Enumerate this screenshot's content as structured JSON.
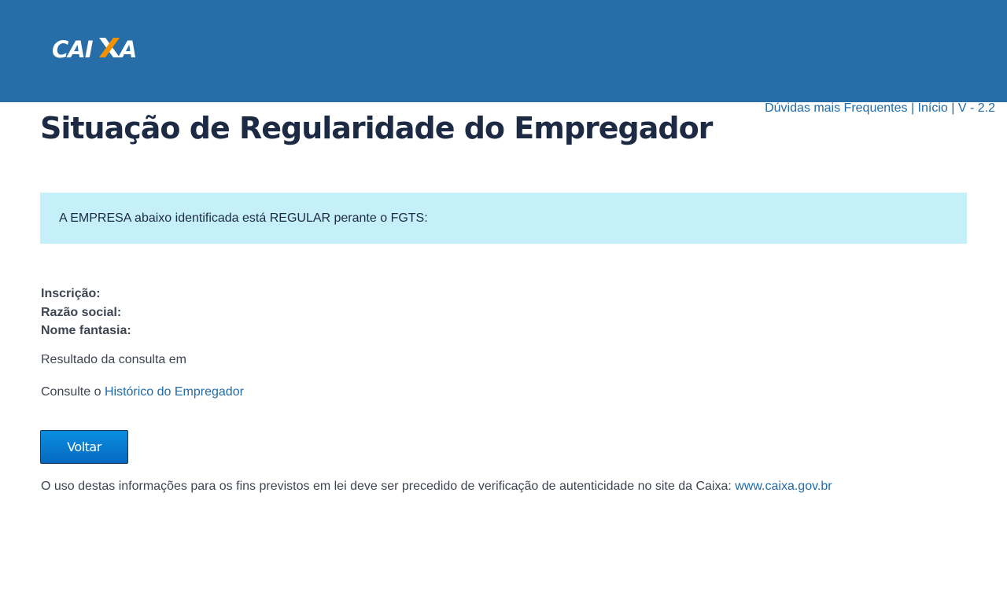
{
  "header": {
    "logo_text": "CAIXA",
    "brand_color": "#276ea9",
    "logo_accent_color": "#f39200"
  },
  "toplinks": {
    "faq_label": "Dúvidas mais Frequentes",
    "separator": "|",
    "home_label": "Início",
    "version_label": "V - 2.2"
  },
  "page": {
    "title": "Situação de Regularidade do Empregador"
  },
  "alert": {
    "message": "A EMPRESA abaixo identificada está REGULAR perante o FGTS:",
    "background": "#c5f0f9"
  },
  "fields": {
    "inscricao_label": "Inscrição:",
    "razao_social_label": "Razão social:",
    "nome_fantasia_label": "Nome fantasia:"
  },
  "result": {
    "text": "Resultado da consulta em"
  },
  "consult": {
    "prefix": "Consulte o",
    "link_label": "Histórico do Empregador"
  },
  "actions": {
    "back_label": "Voltar"
  },
  "footer": {
    "text": "O uso destas informações para os fins previstos em lei deve ser precedido de verificação de autenticidade no site da Caixa:",
    "link_label": "www.caixa.gov.br"
  }
}
